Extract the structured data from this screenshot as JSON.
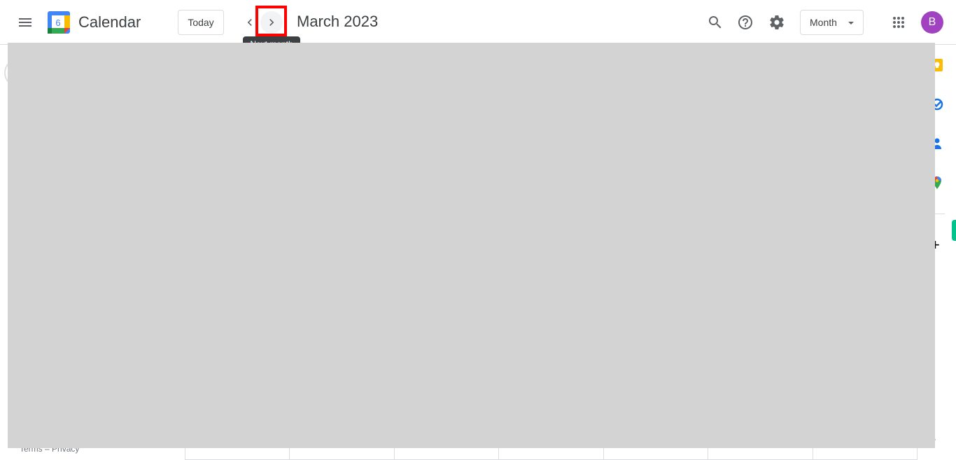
{
  "header": {
    "app_title": "Calendar",
    "logo_day": "6",
    "today_label": "Today",
    "prev_label": "Previous month",
    "next_tooltip": "Next month",
    "period_title": "March 2023",
    "view_select": {
      "selected": "Month"
    },
    "avatar_initial": "B"
  },
  "icons": {
    "menu": "menu-icon",
    "prev": "chevron-left-icon",
    "next": "chevron-right-icon",
    "search": "search-icon",
    "help": "help-icon",
    "settings": "gear-icon",
    "apps": "apps-grid-icon",
    "caret": "caret-down-icon"
  },
  "side_panel": {
    "items": [
      {
        "name": "keep",
        "icon": "keep-icon"
      },
      {
        "name": "tasks",
        "icon": "tasks-icon"
      },
      {
        "name": "contacts",
        "icon": "contacts-icon"
      },
      {
        "name": "maps",
        "icon": "maps-icon"
      }
    ],
    "add_label": "+",
    "expand_label": "›"
  },
  "footer": {
    "terms": "Terms",
    "separator": "–",
    "privacy": "Privacy"
  },
  "month_grid": {
    "visible_bottom_cells": 7
  },
  "colors": {
    "avatar": "#a142c1",
    "highlight": "#ff0000",
    "overlay": "#d3d3d3",
    "keep": "#fbbc04",
    "tasks": "#1a73e8",
    "contacts": "#1a73e8",
    "green_tab": "#00c48c"
  }
}
